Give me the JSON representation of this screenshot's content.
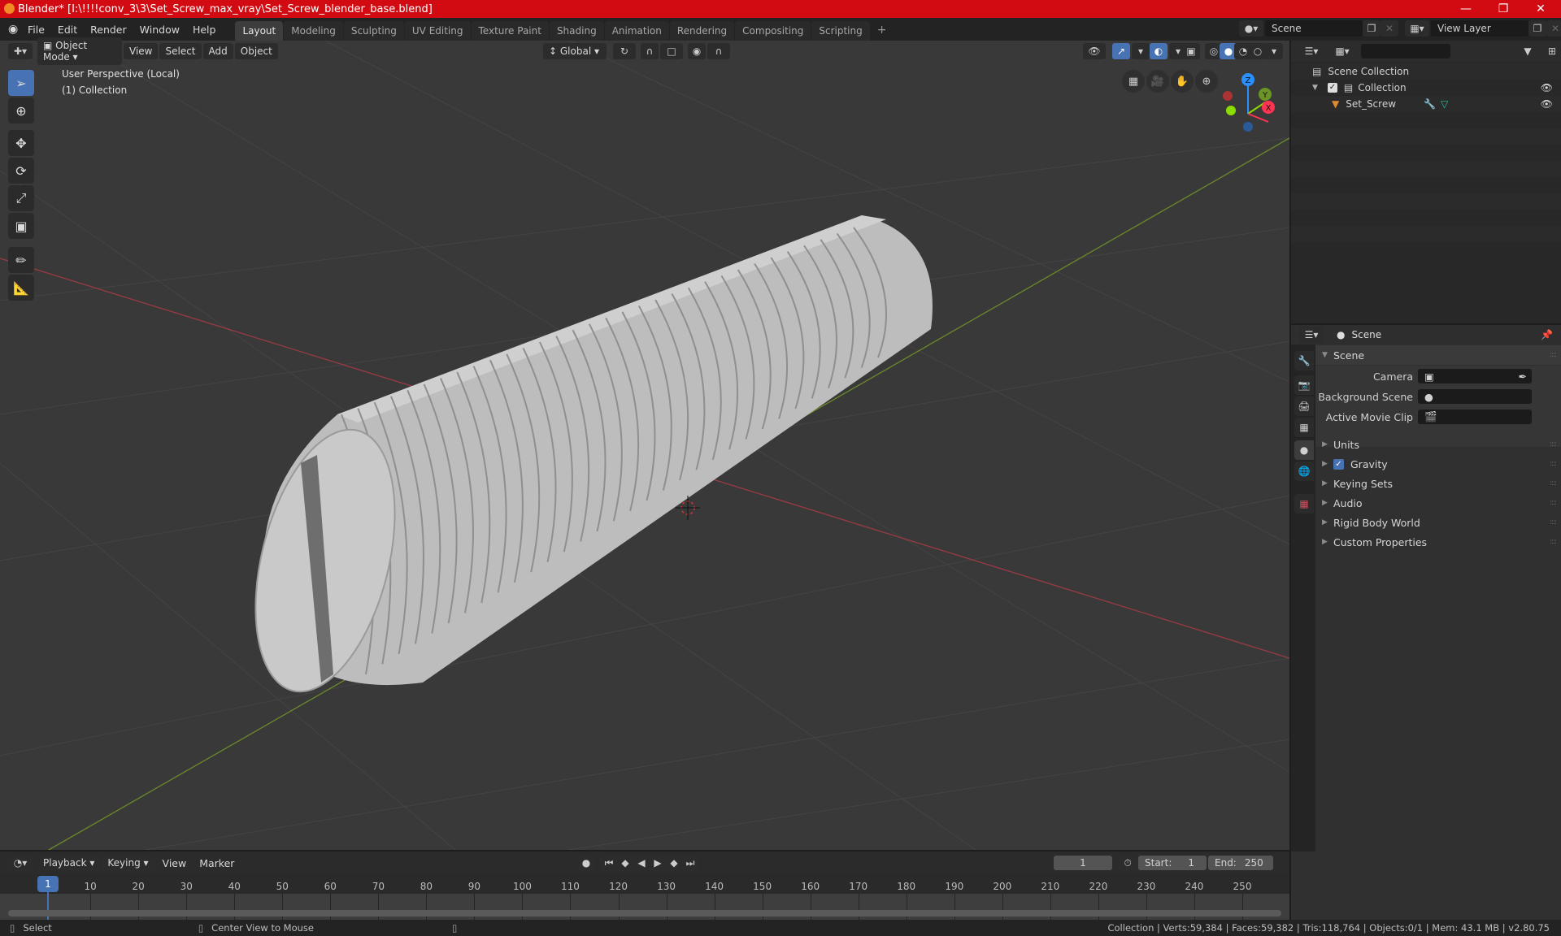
{
  "window": {
    "title": "Blender* [I:\\!!!!conv_3\\3\\Set_Screw_max_vray\\Set_Screw_blender_base.blend]",
    "controls": [
      "minimize",
      "restore",
      "close"
    ]
  },
  "menubar": {
    "items": [
      "File",
      "Edit",
      "Render",
      "Window",
      "Help"
    ],
    "workspace_tabs": [
      "Layout",
      "Modeling",
      "Sculpting",
      "UV Editing",
      "Texture Paint",
      "Shading",
      "Animation",
      "Rendering",
      "Compositing",
      "Scripting"
    ],
    "active_tab": "Layout",
    "add_tab_label": "+",
    "scene_name": "Scene",
    "view_layer_name": "View Layer"
  },
  "viewport_header": {
    "mode": "Object Mode",
    "menus": [
      "View",
      "Select",
      "Add",
      "Object"
    ],
    "transform_orientation": "Global"
  },
  "viewport": {
    "perspective_label": "User Perspective (Local)",
    "collection_label": "(1) Collection",
    "object": "Set_Screw",
    "gizmo_axes": [
      "Z",
      "Y",
      "X"
    ],
    "colors": {
      "x_axis": "#ff3352",
      "y_axis": "#8bdc00",
      "z_axis": "#2890ff",
      "grid_bg": "#393939",
      "mesh": "#c4c4c4",
      "active_tool": "#4772b3"
    }
  },
  "toolbar": {
    "tools": [
      "select-box",
      "cursor",
      "move",
      "rotate",
      "scale",
      "transform",
      "annotate",
      "measure"
    ],
    "active": "select-box"
  },
  "outliner": {
    "search_placeholder": "",
    "root": "Scene Collection",
    "items": [
      {
        "name": "Collection",
        "checked": true,
        "visible": true
      },
      {
        "name": "Set_Screw",
        "visible": true
      }
    ]
  },
  "properties": {
    "context": "Scene",
    "panel_title": "Scene",
    "fields": [
      {
        "label": "Camera",
        "value": ""
      },
      {
        "label": "Background Scene",
        "value": ""
      },
      {
        "label": "Active Movie Clip",
        "value": ""
      }
    ],
    "subpanels": [
      {
        "label": "Units"
      },
      {
        "label": "Gravity",
        "checkbox": true
      },
      {
        "label": "Keying Sets"
      },
      {
        "label": "Audio"
      },
      {
        "label": "Rigid Body World"
      },
      {
        "label": "Custom Properties"
      }
    ]
  },
  "timeline": {
    "menus": [
      "Playback",
      "Keying",
      "View",
      "Marker"
    ],
    "current_frame": "1",
    "start_label": "Start:",
    "start": "1",
    "end_label": "End:",
    "end": "250",
    "ticks": [
      "10",
      "20",
      "30",
      "40",
      "50",
      "60",
      "70",
      "80",
      "90",
      "100",
      "110",
      "120",
      "130",
      "140",
      "150",
      "160",
      "170",
      "180",
      "190",
      "200",
      "210",
      "220",
      "230",
      "240",
      "250"
    ]
  },
  "statusbar": {
    "left": "Select",
    "middle": "Center View to Mouse",
    "stats": "Collection | Verts:59,384 | Faces:59,382 | Tris:118,764 | Objects:0/1 | Mem: 43.1 MB | v2.80.75"
  }
}
